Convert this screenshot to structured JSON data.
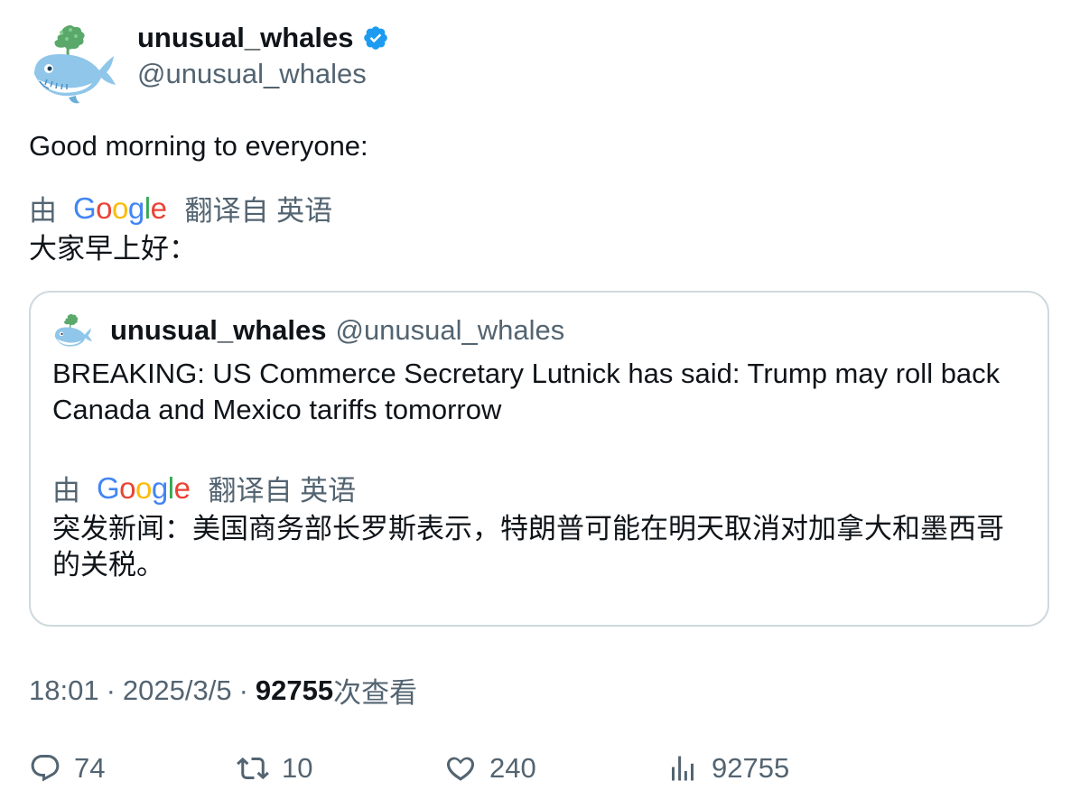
{
  "author": {
    "display_name": "unusual_whales",
    "handle": "@unusual_whales"
  },
  "tweet": {
    "text": "Good morning to everyone:",
    "translation": {
      "by_label": "由",
      "translated_from_label": "翻译自 英语",
      "text": "大家早上好："
    }
  },
  "quoted_tweet": {
    "display_name": "unusual_whales",
    "handle": "@unusual_whales",
    "text": "BREAKING: US Commerce Secretary Lutnick has said: Trump may roll back Canada and Mexico tariffs tomorrow",
    "translation": {
      "by_label": "由",
      "translated_from_label": "翻译自 英语",
      "text": "突发新闻：美国商务部长罗斯表示，特朗普可能在明天取消对加拿大和墨西哥的关税。"
    }
  },
  "meta": {
    "time": "18:01",
    "separator": "·",
    "date": "2025/3/5",
    "views_count": "92755",
    "views_suffix": "次查看"
  },
  "actions": {
    "replies": "74",
    "retweets": "10",
    "likes": "240",
    "views": "92755"
  },
  "colors": {
    "verified_blue": "#1d9bf0",
    "secondary_text": "#536471",
    "border": "#cfd9de"
  },
  "icons": [
    "whale-avatar-icon",
    "verified-badge-icon",
    "reply-icon",
    "retweet-icon",
    "like-icon",
    "views-icon"
  ]
}
